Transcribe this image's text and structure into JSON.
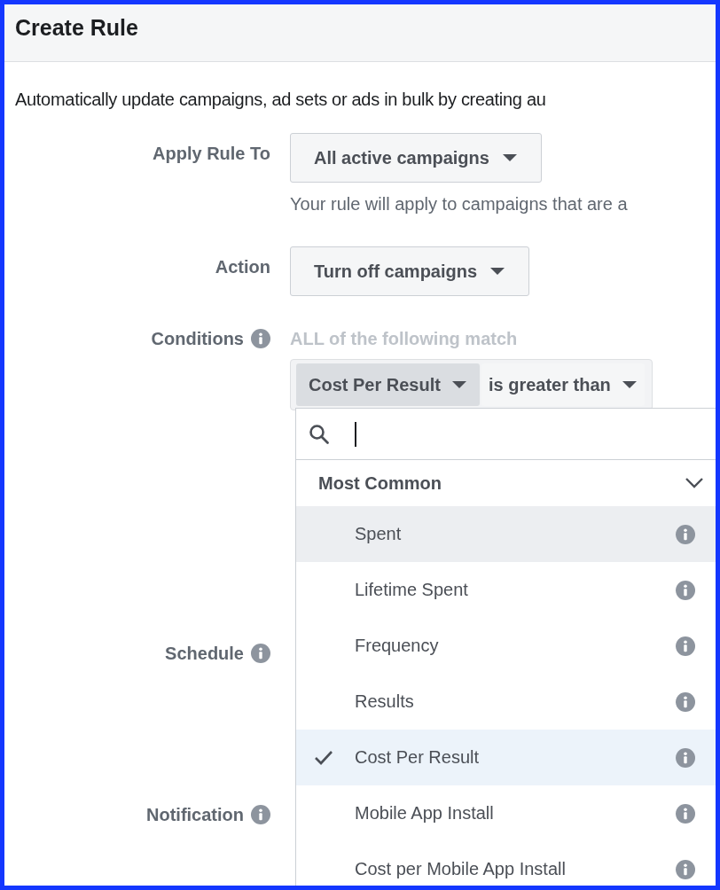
{
  "dialog": {
    "title": "Create Rule"
  },
  "description": "Automatically update campaigns, ad sets or ads in bulk by creating au",
  "fields": [
    {
      "kind": "select",
      "label": "Apply Rule To",
      "info": false,
      "value": "All active campaigns",
      "hint": "Your rule will apply to campaigns that are a"
    },
    {
      "kind": "select",
      "label": "Action",
      "info": false,
      "value": "Turn off campaigns"
    },
    {
      "kind": "conditions",
      "label": "Conditions",
      "info": true,
      "mode": "ALL of the following match",
      "metric": "Cost Per Result",
      "operator": "is greater than"
    },
    {
      "kind": "blank",
      "label": "Schedule",
      "info": true
    },
    {
      "kind": "blank",
      "label": "Notification",
      "info": true
    }
  ],
  "metric_menu": {
    "section": {
      "title": "Most Common",
      "expanded": true
    },
    "items": [
      {
        "label": "Spent",
        "hovered": true,
        "selected": false
      },
      {
        "label": "Lifetime Spent",
        "hovered": false,
        "selected": false
      },
      {
        "label": "Frequency",
        "hovered": false,
        "selected": false
      },
      {
        "label": "Results",
        "hovered": false,
        "selected": false
      },
      {
        "label": "Cost Per Result",
        "hovered": false,
        "selected": true
      },
      {
        "label": "Mobile App Install",
        "hovered": false,
        "selected": false
      },
      {
        "label": "Cost per Mobile App Install",
        "hovered": false,
        "selected": false
      }
    ]
  }
}
